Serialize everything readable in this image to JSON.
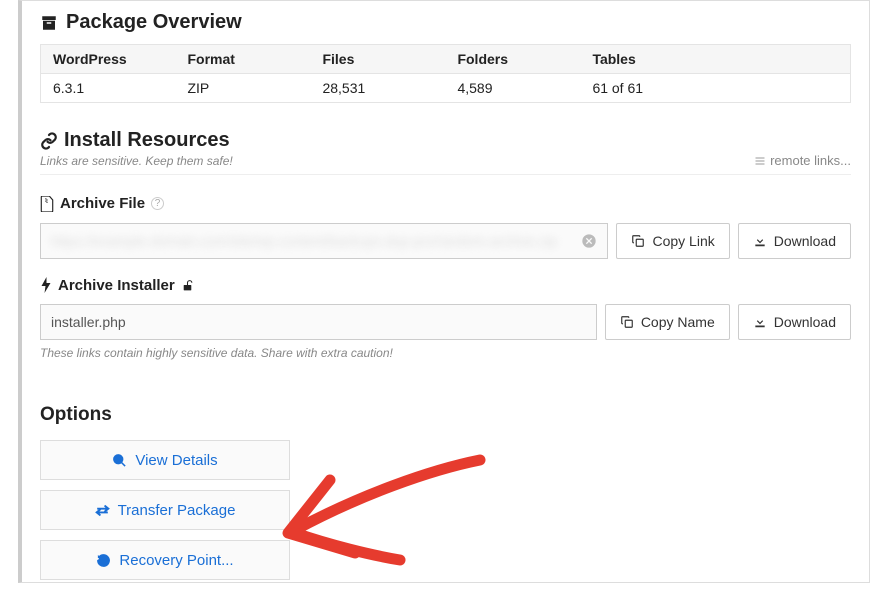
{
  "package_overview": {
    "title": "Package Overview",
    "headers": {
      "wordpress": "WordPress",
      "format": "Format",
      "files": "Files",
      "folders": "Folders",
      "tables": "Tables"
    },
    "values": {
      "wordpress": "6.3.1",
      "format": "ZIP",
      "files": "28,531",
      "folders": "4,589",
      "tables": "61 of 61"
    }
  },
  "install_resources": {
    "title": "Install Resources",
    "sensitive_note": "Links are sensitive. Keep them safe!",
    "remote_links_label": "remote links..."
  },
  "archive_file": {
    "label": "Archive File",
    "value_placeholder": "https://example-domain.com/site/wp-content/backups-dup-pro/random-archive.zip",
    "copy_label": "Copy Link",
    "download_label": "Download"
  },
  "archive_installer": {
    "label": "Archive Installer",
    "value": "installer.php",
    "copy_label": "Copy Name",
    "download_label": "Download",
    "caution_note": "These links contain highly sensitive data. Share with extra caution!"
  },
  "options": {
    "title": "Options",
    "view_details": "View Details",
    "transfer_package": "Transfer Package",
    "recovery_point": "Recovery Point..."
  }
}
